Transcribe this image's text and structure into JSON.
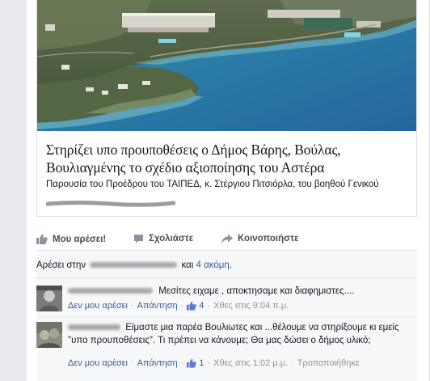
{
  "post": {
    "preview": {
      "title": "Στηρίζει υπο προυποθέσεις ο Δήμος Βάρης, Βούλας, Βουλιαγμένης το σχέδιο αξιοποίησης του Αστέρα",
      "description": "Παρουσία του Προέδρου του ΤΑΙΠΕΔ, κ. Στέργιου Πιτσιόρλα, του βοηθού Γενικού"
    },
    "actions": {
      "like_label": "Μου αρέσει!",
      "comment_label": "Σχολιάστε",
      "share_label": "Κοινοποιήστε",
      "like_icon": "thumbs-up-icon",
      "comment_icon": "comment-icon",
      "share_icon": "share-arrow-icon"
    }
  },
  "likes_summary": {
    "prefix": "Αρέσει στην",
    "connector": "και",
    "others_link": "4 ακόμη",
    "suffix": "."
  },
  "comments": [
    {
      "text": "Μεσίτες ειχαμε , αποκτησαμε και διαφημιστες....",
      "dislike_label": "Δεν μου αρέσει",
      "reply_label": "Απάντηση",
      "like_count": "4",
      "time": "Χθες στις 9:04 π.μ."
    },
    {
      "text": "Είμαστε μια παρέα Βουλιωτες και ...θέλουμε να στηρίξουμε κι εμείς \"υπο προυποθέσεις\". Τι πρέπει να κάνουμε; Θα μας δώσει ο δήμος υλικό;",
      "dislike_label": "Δεν μου αρέσει",
      "reply_label": "Απάντηση",
      "like_count": "1",
      "time": "Χθες στις 1:02 μ.μ.",
      "edit_label": "Τροποποιήθηκε"
    }
  ],
  "colors": {
    "link": "#3b5998",
    "meta": "#90949c",
    "background": "#e9ebee"
  }
}
